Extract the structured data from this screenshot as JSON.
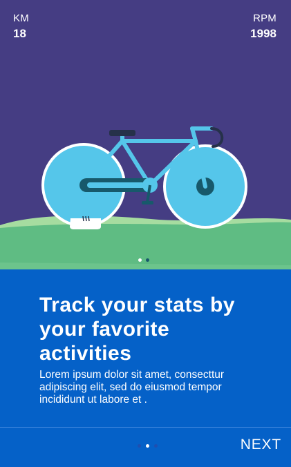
{
  "stats": {
    "left_label": "KM",
    "left_value": "18",
    "right_label": "RPM",
    "right_value": "1998"
  },
  "hero": {
    "illustration": "bicycle-on-grass",
    "pager_active_index": 1,
    "pager_count": 2
  },
  "onboarding": {
    "headline_line1": "Track your stats by",
    "headline_line2": "your favorite",
    "headline_line3": "activities",
    "body_line1": "Lorem ipsum dolor sit amet, consecttur",
    "body_line2": "adipiscing elit, sed do eiusmod tempor",
    "body_line3": "incididunt ut labore et ."
  },
  "footer": {
    "next_label": "NEXT",
    "pager_active_index": 1,
    "pager_count": 3
  },
  "colors": {
    "sky": "#453d83",
    "grass": "#5fbc83",
    "grass_light": "#8fd39a",
    "panel": "#0561c8",
    "wheel": "#55c6ea",
    "frame": "#55c6ea",
    "dark_teal": "#17596b",
    "white": "#ffffff"
  }
}
